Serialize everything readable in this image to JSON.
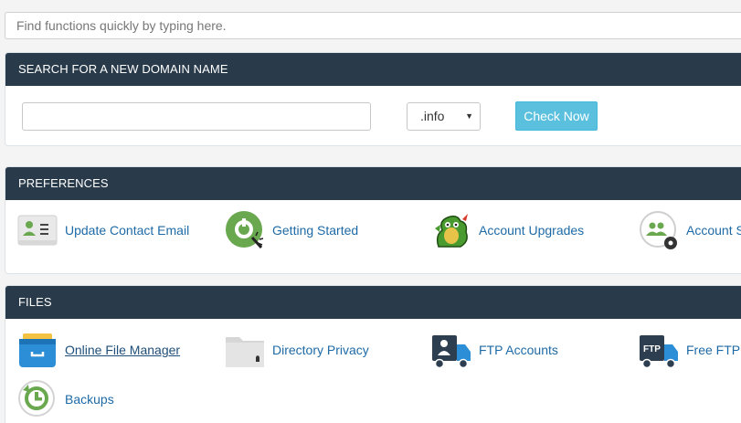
{
  "search": {
    "placeholder": "Find functions quickly by typing here."
  },
  "domain_panel": {
    "title": "SEARCH FOR A NEW DOMAIN NAME",
    "input_value": "",
    "tld_selected": ".info",
    "check_button": "Check Now"
  },
  "preferences": {
    "title": "PREFERENCES",
    "items": [
      {
        "label": "Update Contact Email",
        "icon": "contact-card-icon"
      },
      {
        "label": "Getting Started",
        "icon": "getting-started-icon"
      },
      {
        "label": "Account Upgrades",
        "icon": "dragon-mascot-icon"
      },
      {
        "label": "Account Se",
        "icon": "user-settings-icon"
      }
    ]
  },
  "files": {
    "title": "FILES",
    "items": [
      {
        "label": "Online File Manager",
        "icon": "file-drawer-icon"
      },
      {
        "label": "Directory Privacy",
        "icon": "locked-folder-icon"
      },
      {
        "label": "FTP Accounts",
        "icon": "ftp-truck-user-icon"
      },
      {
        "label": "Free FTP S",
        "icon": "ftp-truck-icon"
      },
      {
        "label": "Backups",
        "icon": "backup-clock-icon"
      }
    ]
  },
  "colors": {
    "header_bg": "#293a4a",
    "link": "#1e6aa6",
    "button_bg": "#5bc0de",
    "accent_green": "#6aa84f"
  }
}
